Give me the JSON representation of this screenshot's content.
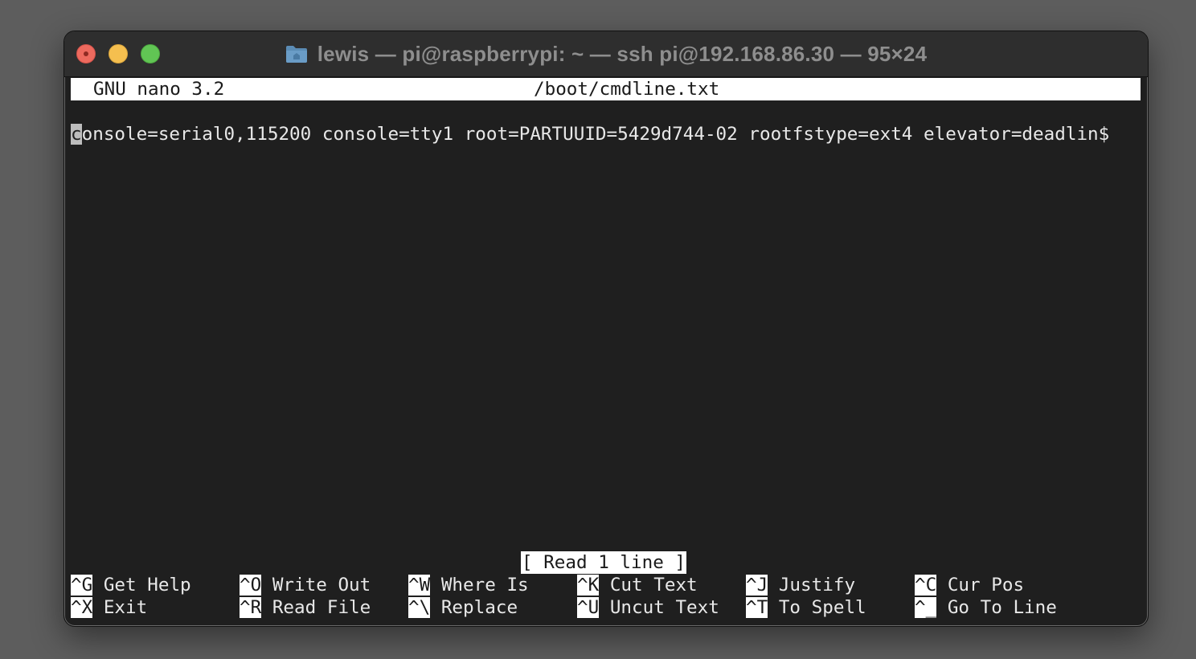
{
  "window": {
    "title": "lewis — pi@raspberrypi: ~ — ssh pi@192.168.86.30 — 95×24",
    "icon": "folder-icon"
  },
  "nano": {
    "version_label": "GNU nano 3.2",
    "filename": "/boot/cmdline.txt",
    "cursor_char": "c",
    "content_line": "onsole=serial0,115200 console=tty1 root=PARTUUID=5429d744-02 rootfstype=ext4 elevator=deadlin$",
    "status_message": "[ Read 1 line ]"
  },
  "shortcuts": {
    "row1": [
      {
        "key": "^G",
        "label": "Get Help"
      },
      {
        "key": "^O",
        "label": "Write Out"
      },
      {
        "key": "^W",
        "label": "Where Is"
      },
      {
        "key": "^K",
        "label": "Cut Text"
      },
      {
        "key": "^J",
        "label": "Justify"
      },
      {
        "key": "^C",
        "label": "Cur Pos"
      }
    ],
    "row2": [
      {
        "key": "^X",
        "label": "Exit"
      },
      {
        "key": "^R",
        "label": "Read File"
      },
      {
        "key": "^\\",
        "label": "Replace"
      },
      {
        "key": "^U",
        "label": "Uncut Text"
      },
      {
        "key": "^T",
        "label": "To Spell"
      },
      {
        "key": "^_",
        "label": "Go To Line"
      }
    ]
  },
  "colors": {
    "terminal_bg": "#1f1f1f",
    "terminal_fg": "#e8e8e8",
    "inverse_bg": "#ffffff",
    "close": "#ed6a5e",
    "minimize": "#f5bf4f",
    "zoom": "#61c554",
    "folder": "#5b8cb5"
  }
}
